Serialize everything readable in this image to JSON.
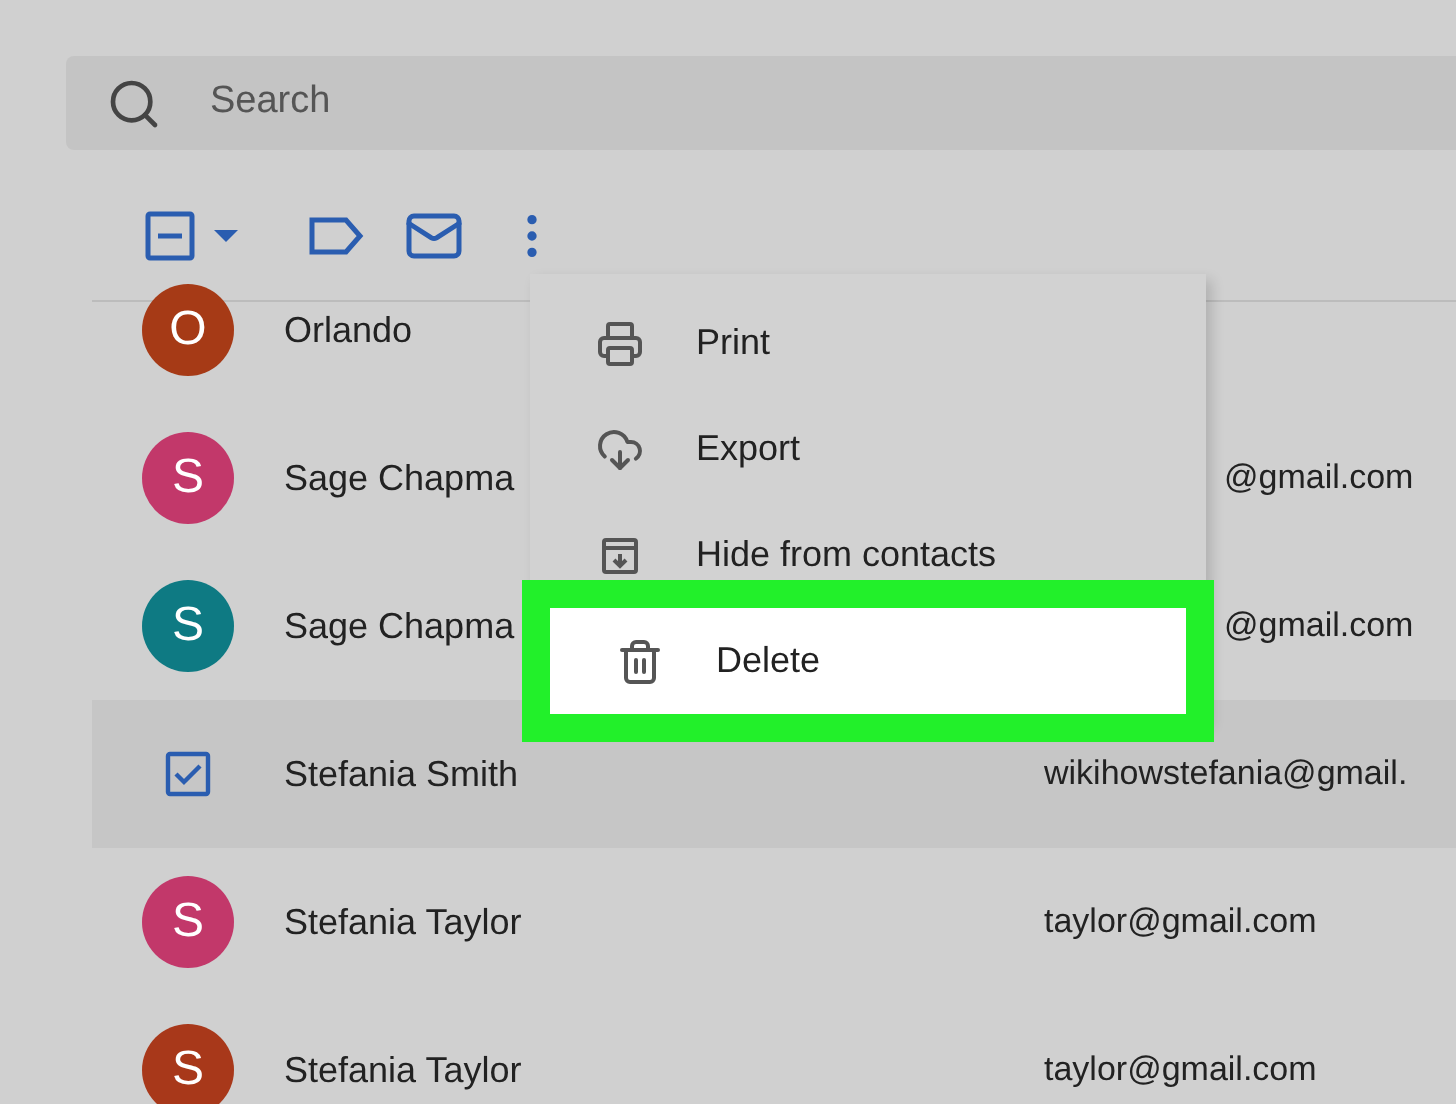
{
  "search": {
    "placeholder": "Search"
  },
  "contacts": [
    {
      "initial": "O",
      "color": "#a63a16",
      "name": "Orlando",
      "selected": false
    },
    {
      "initial": "S",
      "color": "#c2386a",
      "name": "Sage Chapma",
      "email": "@gmail.com",
      "selected": false,
      "partly_hidden": true
    },
    {
      "initial": "S",
      "color": "#0e7a83",
      "name": "Sage Chapma",
      "email": "@gmail.com",
      "selected": false,
      "partly_hidden": true
    },
    {
      "name": "Stefania Smith",
      "email": "wikihowstefania@gmail.",
      "selected": true,
      "partly_hidden": false
    },
    {
      "initial": "S",
      "color": "#c2386a",
      "name": "Stefania Taylor",
      "email": "taylor@gmail.com",
      "selected": false,
      "partly_hidden": false
    },
    {
      "initial": "S",
      "color": "#a8381a",
      "name": "Stefania Taylor",
      "email": "taylor@gmail.com",
      "selected": false,
      "partly_hidden": false
    }
  ],
  "menu": [
    {
      "kind": "print",
      "label": "Print",
      "highlighted": false
    },
    {
      "kind": "export",
      "label": "Export",
      "highlighted": false
    },
    {
      "kind": "hide",
      "label": "Hide from contacts",
      "highlighted": false
    },
    {
      "kind": "delete",
      "label": "Delete",
      "highlighted": true
    }
  ]
}
